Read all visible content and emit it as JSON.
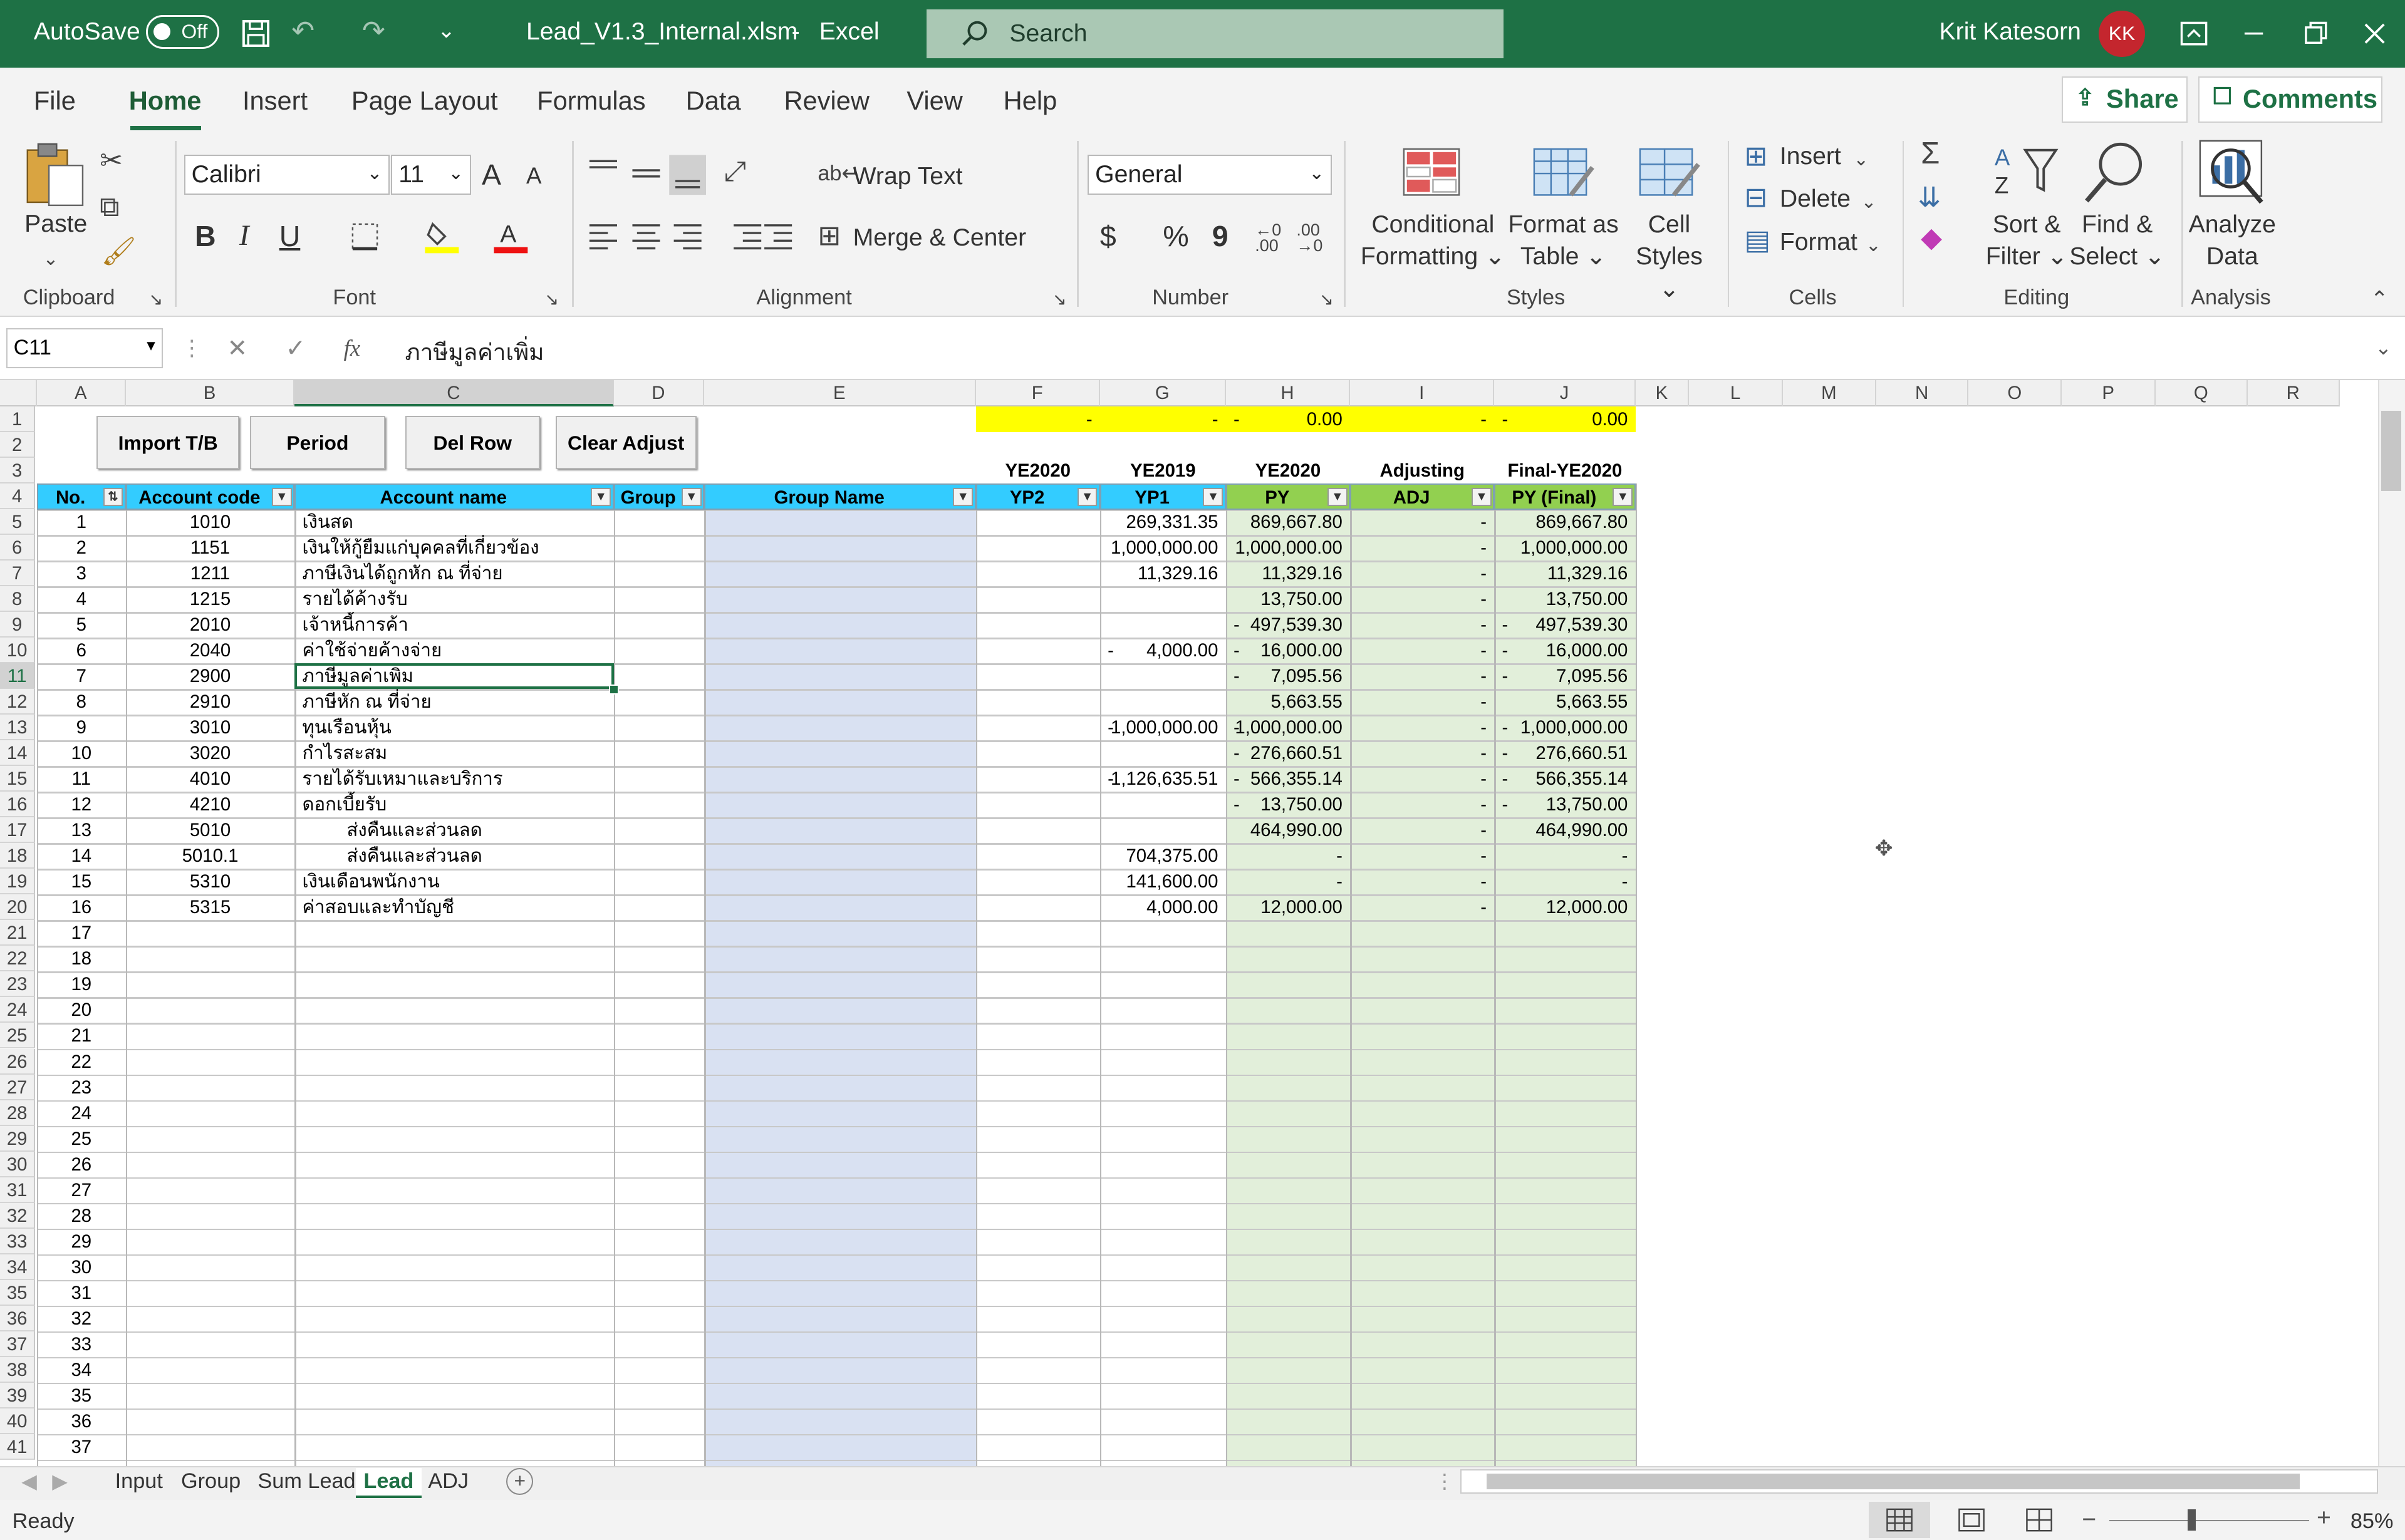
{
  "title_bar": {
    "autosave_label": "AutoSave",
    "autosave_state": "Off",
    "filename": "Lead_V1.3_Internal.xlsm",
    "separator": "-",
    "app": "Excel",
    "search_placeholder": "Search",
    "user_name": "Krit Katesorn",
    "user_initials": "KK"
  },
  "ribbon_tabs": [
    "File",
    "Home",
    "Insert",
    "Page Layout",
    "Formulas",
    "Data",
    "Review",
    "View",
    "Help"
  ],
  "active_tab": "Home",
  "share_label": "Share",
  "comments_label": "Comments",
  "ribbon": {
    "clipboard": {
      "paste": "Paste",
      "group": "Clipboard"
    },
    "font": {
      "name": "Calibri",
      "size": "11",
      "group": "Font",
      "bold": "B",
      "italic": "I",
      "underline": "U",
      "grow": "A",
      "shrink": "A",
      "color_letter": "A"
    },
    "alignment": {
      "wrap": "Wrap Text",
      "merge": "Merge & Center",
      "group": "Alignment"
    },
    "number": {
      "format": "General",
      "currency": "$",
      "percent": "%",
      "comma": "9",
      "group": "Number"
    },
    "styles": {
      "conditional_1": "Conditional",
      "conditional_2": "Formatting",
      "format_table_1": "Format as",
      "format_table_2": "Table",
      "cell_styles_1": "Cell",
      "cell_styles_2": "Styles",
      "group": "Styles"
    },
    "cells": {
      "insert": "Insert",
      "delete": "Delete",
      "format": "Format",
      "group": "Cells"
    },
    "editing": {
      "sort_1": "Sort &",
      "sort_2": "Filter",
      "find_1": "Find &",
      "find_2": "Select",
      "group": "Editing"
    },
    "analysis": {
      "analyze_1": "Analyze",
      "analyze_2": "Data",
      "group": "Analysis"
    },
    "accent": "#1e7145"
  },
  "formula_bar": {
    "name_box": "C11",
    "fx": "fx",
    "content": "ภาษีมูลค่าเพิ่ม"
  },
  "columns": [
    "A",
    "B",
    "C",
    "D",
    "E",
    "F",
    "G",
    "H",
    "I",
    "J",
    "K",
    "L",
    "M",
    "N",
    "O",
    "P",
    "Q",
    "R"
  ],
  "row_numbers": [
    "1",
    "2",
    "3",
    "4",
    "5",
    "6",
    "7",
    "8",
    "9",
    "10",
    "11",
    "12",
    "13",
    "14",
    "15",
    "16",
    "17",
    "18",
    "19",
    "20",
    "21",
    "22",
    "23",
    "24",
    "25",
    "26",
    "27",
    "28",
    "29",
    "30",
    "31",
    "32",
    "33",
    "34",
    "35",
    "36",
    "37",
    "38",
    "39",
    "40",
    "41"
  ],
  "buttons": [
    "Import T/B",
    "Period",
    "Del Row",
    "Clear Adjust"
  ],
  "row1": {
    "f": "-",
    "g": "-",
    "h_dash": "-",
    "h": "0.00",
    "i": "-",
    "j_dash": "-",
    "j": "0.00"
  },
  "period_headers": {
    "f": "YE2020",
    "g": "YE2019",
    "h": "YE2020",
    "i": "Adjusting",
    "j": "Final-YE2020"
  },
  "table_headers": {
    "no": "No.",
    "account_code": "Account code",
    "account_name": "Account name",
    "group": "Group",
    "group_name": "Group Name",
    "yp2": "YP2",
    "yp1": "YP1",
    "py": "PY",
    "adj": "ADJ",
    "py_final": "PY (Final)"
  },
  "rows": [
    {
      "no": "1",
      "code": "1010",
      "name": "เงินสด",
      "indent": false,
      "g": "269,331.35",
      "g_neg": false,
      "h": "869,667.80",
      "h_neg": false,
      "i": "-",
      "j": "869,667.80",
      "j_neg": false
    },
    {
      "no": "2",
      "code": "1151",
      "name": "เงินให้กู้ยืมแก่บุคคลที่เกี่ยวข้อง",
      "indent": false,
      "g": "1,000,000.00",
      "g_neg": false,
      "h": "1,000,000.00",
      "h_neg": false,
      "i": "-",
      "j": "1,000,000.00",
      "j_neg": false
    },
    {
      "no": "3",
      "code": "1211",
      "name": "ภาษีเงินได้ถูกหัก ณ ที่จ่าย",
      "indent": false,
      "g": "11,329.16",
      "g_neg": false,
      "h": "11,329.16",
      "h_neg": false,
      "i": "-",
      "j": "11,329.16",
      "j_neg": false
    },
    {
      "no": "4",
      "code": "1215",
      "name": "รายได้ค้างรับ",
      "indent": false,
      "g": "",
      "g_neg": false,
      "h": "13,750.00",
      "h_neg": false,
      "i": "-",
      "j": "13,750.00",
      "j_neg": false
    },
    {
      "no": "5",
      "code": "2010",
      "name": "เจ้าหนี้การค้า",
      "indent": false,
      "g": "",
      "g_neg": false,
      "h": "497,539.30",
      "h_neg": true,
      "i": "-",
      "j": "497,539.30",
      "j_neg": true
    },
    {
      "no": "6",
      "code": "2040",
      "name": "ค่าใช้จ่ายค้างจ่าย",
      "indent": false,
      "g": "4,000.00",
      "g_neg": true,
      "h": "16,000.00",
      "h_neg": true,
      "i": "-",
      "j": "16,000.00",
      "j_neg": true
    },
    {
      "no": "7",
      "code": "2900",
      "name": "ภาษีมูลค่าเพิ่ม",
      "indent": false,
      "g": "",
      "g_neg": false,
      "h": "7,095.56",
      "h_neg": true,
      "i": "-",
      "j": "7,095.56",
      "j_neg": true
    },
    {
      "no": "8",
      "code": "2910",
      "name": "ภาษีหัก ณ ที่จ่าย",
      "indent": false,
      "g": "",
      "g_neg": false,
      "h": "5,663.55",
      "h_neg": false,
      "i": "-",
      "j": "5,663.55",
      "j_neg": false
    },
    {
      "no": "9",
      "code": "3010",
      "name": "ทุนเรือนหุ้น",
      "indent": false,
      "g": "1,000,000.00",
      "g_neg": true,
      "h": "1,000,000.00",
      "h_neg": true,
      "i": "-",
      "j": "1,000,000.00",
      "j_neg": true
    },
    {
      "no": "10",
      "code": "3020",
      "name": "กำไรสะสม",
      "indent": false,
      "g": "",
      "g_neg": false,
      "h": "276,660.51",
      "h_neg": true,
      "i": "-",
      "j": "276,660.51",
      "j_neg": true
    },
    {
      "no": "11",
      "code": "4010",
      "name": "รายได้รับเหมาและบริการ",
      "indent": false,
      "g": "1,126,635.51",
      "g_neg": true,
      "h": "566,355.14",
      "h_neg": true,
      "i": "-",
      "j": "566,355.14",
      "j_neg": true
    },
    {
      "no": "12",
      "code": "4210",
      "name": "ดอกเบี้ยรับ",
      "indent": false,
      "g": "",
      "g_neg": false,
      "h": "13,750.00",
      "h_neg": true,
      "i": "-",
      "j": "13,750.00",
      "j_neg": true
    },
    {
      "no": "13",
      "code": "5010",
      "name": "ส่งคืนและส่วนลด",
      "indent": true,
      "g": "",
      "g_neg": false,
      "h": "464,990.00",
      "h_neg": false,
      "i": "-",
      "j": "464,990.00",
      "j_neg": false
    },
    {
      "no": "14",
      "code": "5010.1",
      "name": "ส่งคืนและส่วนลด",
      "indent": true,
      "g": "704,375.00",
      "g_neg": false,
      "h": "-",
      "h_neg": false,
      "i": "-",
      "j": "-",
      "j_neg": false
    },
    {
      "no": "15",
      "code": "5310",
      "name": "เงินเดือนพนักงาน",
      "indent": false,
      "g": "141,600.00",
      "g_neg": false,
      "h": "-",
      "h_neg": false,
      "i": "-",
      "j": "-",
      "j_neg": false
    },
    {
      "no": "16",
      "code": "5315",
      "name": "ค่าสอบและทำบัญชี",
      "indent": false,
      "g": "4,000.00",
      "g_neg": false,
      "h": "12,000.00",
      "h_neg": false,
      "i": "-",
      "j": "12,000.00",
      "j_neg": false
    }
  ],
  "empty_numbers": [
    "17",
    "18",
    "19",
    "20",
    "21",
    "22",
    "23",
    "24",
    "25",
    "26",
    "27",
    "28",
    "29",
    "30",
    "31",
    "32",
    "33",
    "34",
    "35",
    "36",
    "37"
  ],
  "sheet_tabs": [
    "Input",
    "Group",
    "Sum Lead",
    "Lead",
    "ADJ"
  ],
  "active_sheet": "Lead",
  "status": {
    "ready": "Ready",
    "zoom": "85%"
  },
  "colors": {
    "header_blue": "#33ccff",
    "header_green": "#92d050",
    "light_blue": "#d9e1f2",
    "light_green": "#e2efda",
    "yellow": "#ffff00"
  }
}
